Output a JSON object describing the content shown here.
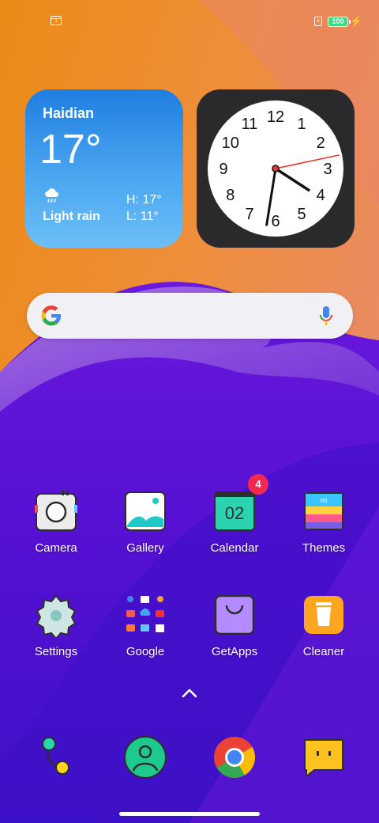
{
  "status_bar": {
    "notification_icon": "calendar-notification-icon",
    "notification_digit": "1",
    "sim_icon": "no-sim-icon",
    "sim_text": "×",
    "battery_level": "100",
    "charging_icon": "bolt-icon"
  },
  "weather": {
    "city": "Haidian",
    "temperature": "17°",
    "condition_icon": "rain-cloud-icon",
    "condition": "Light rain",
    "high": "H: 17°",
    "low": "L: 11°"
  },
  "clock": {
    "numerals": [
      "12",
      "1",
      "2",
      "3",
      "4",
      "5",
      "6",
      "7",
      "8",
      "9",
      "10",
      "11"
    ],
    "time_shown": {
      "hour": 4.1,
      "minute": 31.5,
      "second": 13
    }
  },
  "search": {
    "logo_icon": "google-g-icon",
    "mic_icon": "microphone-icon"
  },
  "apps": [
    {
      "label": "Camera",
      "icon": "camera-icon"
    },
    {
      "label": "Gallery",
      "icon": "gallery-icon"
    },
    {
      "label": "Calendar",
      "icon": "calendar-icon",
      "icon_date": "02",
      "badge": "4"
    },
    {
      "label": "Themes",
      "icon": "themes-icon",
      "icon_text": "mi"
    },
    {
      "label": "Settings",
      "icon": "settings-gear-icon"
    },
    {
      "label": "Google",
      "icon": "google-folder-icon"
    },
    {
      "label": "GetApps",
      "icon": "getapps-bag-icon"
    },
    {
      "label": "Cleaner",
      "icon": "cleaner-trash-icon"
    }
  ],
  "dock": [
    {
      "name": "phone",
      "icon": "phone-icon"
    },
    {
      "name": "contacts",
      "icon": "contacts-icon"
    },
    {
      "name": "chrome",
      "icon": "chrome-icon"
    },
    {
      "name": "messages",
      "icon": "messages-icon"
    }
  ],
  "drawer_icon": "chevron-up-icon",
  "colors": {
    "wallpaper_orange": "#ee8a1c",
    "wallpaper_purple": "#5614d4",
    "weather_blue": "#2a8ae6",
    "badge_red": "#f2294e",
    "clock_second_hand": "#e8392c"
  }
}
